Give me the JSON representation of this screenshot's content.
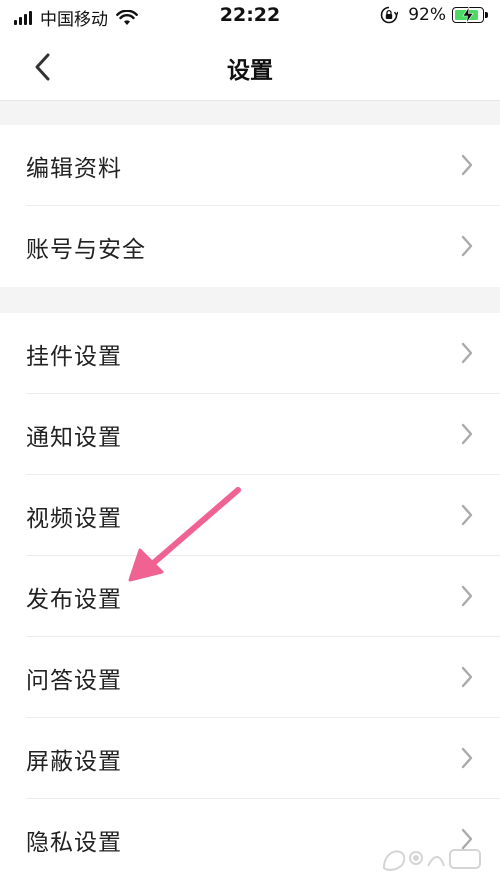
{
  "status_bar": {
    "carrier": "中国移动",
    "time": "22:22",
    "battery_percent": "92%",
    "battery_level": 0.92
  },
  "nav": {
    "title": "设置"
  },
  "sections": [
    {
      "items": [
        {
          "label": "编辑资料"
        },
        {
          "label": "账号与安全"
        }
      ]
    },
    {
      "items": [
        {
          "label": "挂件设置"
        },
        {
          "label": "通知设置"
        },
        {
          "label": "视频设置"
        },
        {
          "label": "发布设置"
        },
        {
          "label": "问答设置"
        },
        {
          "label": "屏蔽设置"
        },
        {
          "label": "隐私设置"
        }
      ]
    }
  ],
  "colors": {
    "annotation_arrow": "#f06292",
    "battery_fill": "#4cd964",
    "section_gap": "#f4f4f4"
  }
}
